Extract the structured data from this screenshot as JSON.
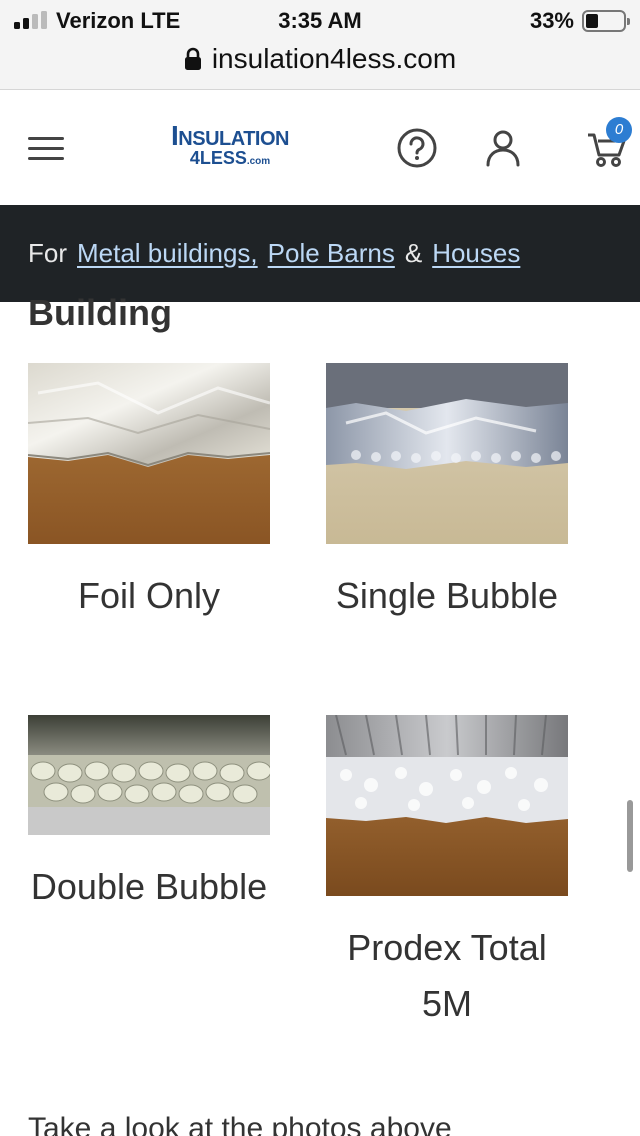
{
  "status_bar": {
    "carrier": "Verizon  LTE",
    "time": "3:35 AM",
    "battery_percent": "33%",
    "battery_level": 0.33
  },
  "url_bar": {
    "url": "insulation4less.com"
  },
  "header": {
    "logo_line1": "Insulation",
    "logo_line2": "4LESS",
    "logo_suffix": ".com",
    "cart_count": "0",
    "brand_color": "#1d4f91",
    "badge_color": "#2d7dd2"
  },
  "banner": {
    "prefix": "For",
    "link1": "Metal buildings,",
    "link2": "Pole Barns",
    "amp": "&",
    "link3": "Houses"
  },
  "section": {
    "heading": "Building"
  },
  "products": [
    {
      "name": "Foil Only",
      "icon": "foil-photo"
    },
    {
      "name": "Single Bubble",
      "icon": "single-bubble-photo"
    },
    {
      "name": "Double Bubble",
      "icon": "double-bubble-photo"
    },
    {
      "name": "Prodex Total 5M",
      "icon": "prodex-photo"
    }
  ],
  "footer_text": "Take a look at the photos above"
}
